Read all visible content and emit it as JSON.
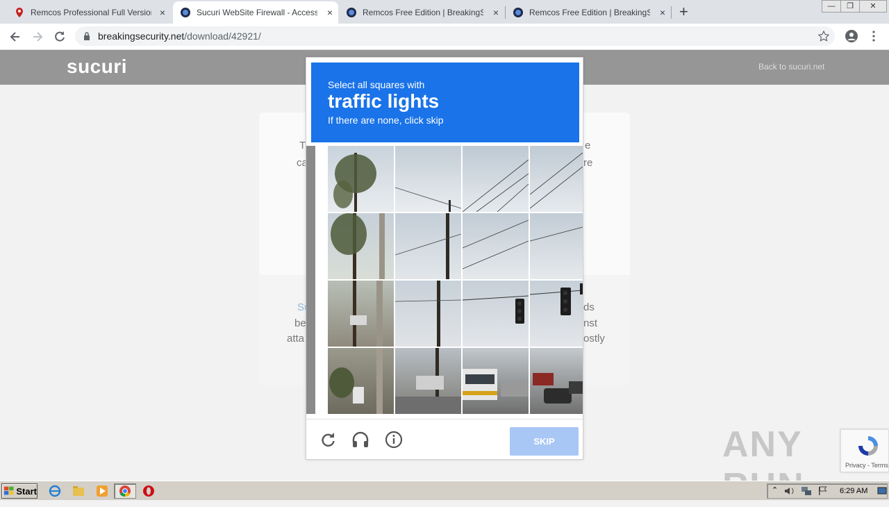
{
  "browser": {
    "tabs": [
      {
        "title": "Remcos Professional Full Version Do",
        "icon": "map-pin-icon"
      },
      {
        "title": "Sucuri WebSite Firewall - Access Den",
        "icon": "shield-favicon-icon",
        "active": true
      },
      {
        "title": "Remcos Free Edition | BreakingSecur",
        "icon": "shield-favicon-icon"
      },
      {
        "title": "Remcos Free Edition | BreakingSecur",
        "icon": "shield-favicon-icon"
      }
    ],
    "new_tab": "+",
    "close_glyph": "×",
    "url_domain": "breakingsecurity.net",
    "url_path": "/download/42921/"
  },
  "page": {
    "logo": "sucuri",
    "back_link": "Back to sucuri.net",
    "card_fragments_left": [
      "T",
      "ca"
    ],
    "card_fragments_right": [
      "e",
      "re"
    ],
    "card_bottom_left": [
      "Su",
      "be",
      "atta"
    ],
    "card_bottom_right": [
      "ds",
      "nst",
      "ostly"
    ]
  },
  "captcha": {
    "instruction_line1": "Select all squares with",
    "target": "traffic lights",
    "instruction_line3": "If there are none, click skip",
    "skip_label": "SKIP",
    "header_color": "#1a73e8",
    "skip_color": "#a9c7f5",
    "icons": [
      "reload-icon",
      "headphones-icon",
      "info-icon"
    ]
  },
  "overlay": {
    "watermark": "ANY RUN",
    "recaptcha_terms": "Privacy - Terms"
  },
  "taskbar": {
    "start_label": "Start",
    "clock": "6:29 AM",
    "apps": [
      "ie-icon",
      "explorer-icon",
      "media-player-icon",
      "chrome-icon",
      "opera-icon"
    ]
  }
}
